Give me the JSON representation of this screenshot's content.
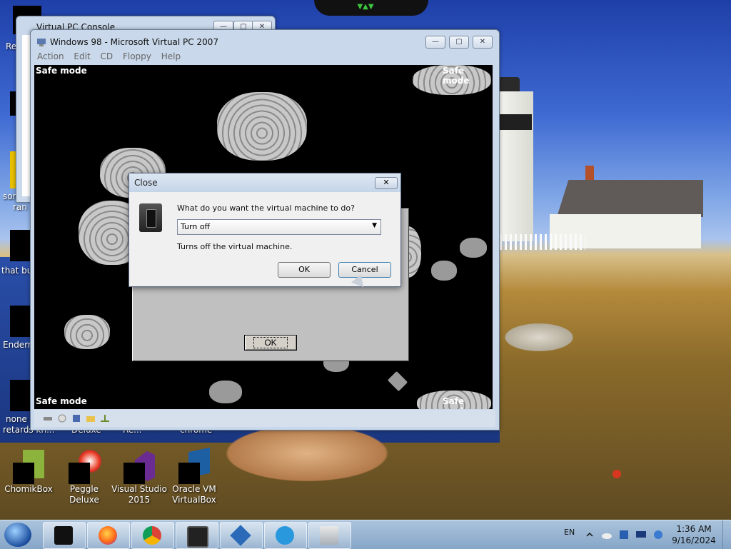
{
  "desktop": {
    "left_labels": [
      "Re",
      "sor",
      "ran a",
      "that bu",
      "Endern",
      "none",
      "retards kn..."
    ],
    "icons": [
      {
        "label": "ChomikBox"
      },
      {
        "label": "Peggle Deluxe"
      },
      {
        "label": "Visual Studio 2015"
      },
      {
        "label": "Oracle VM VirtualBox"
      }
    ],
    "partial_labels": [
      "Deluxe",
      "Re...",
      "chrome"
    ]
  },
  "console_window": {
    "title": "Virtual PC Console"
  },
  "vpc_window": {
    "title": "Windows 98 - Microsoft Virtual PC 2007",
    "menu": [
      "Action",
      "Edit",
      "CD",
      "Floppy",
      "Help"
    ],
    "guest": {
      "safe_mode_label": "Safe mode",
      "ok_button": "OK"
    }
  },
  "close_dialog": {
    "title": "Close",
    "close_glyph": "✕",
    "question": "What do you want the virtual machine to do?",
    "selected_option": "Turn off",
    "description": "Turns off the virtual machine.",
    "ok_label": "OK",
    "cancel_label": "Cancel"
  },
  "taskbar": {
    "language": "EN",
    "time": "1:36 AM",
    "date": "9/16/2024",
    "pinned": [
      "terminal-icon",
      "firefox-icon",
      "chrome-icon",
      "remote-desktop-icon",
      "virtualbox-icon",
      "skype-icon",
      "virtual-pc-icon"
    ]
  },
  "colors": {
    "accent_cancel": "#3c7fb1",
    "guest_bg": "#000000",
    "taskbar": "#9cb8d6"
  }
}
